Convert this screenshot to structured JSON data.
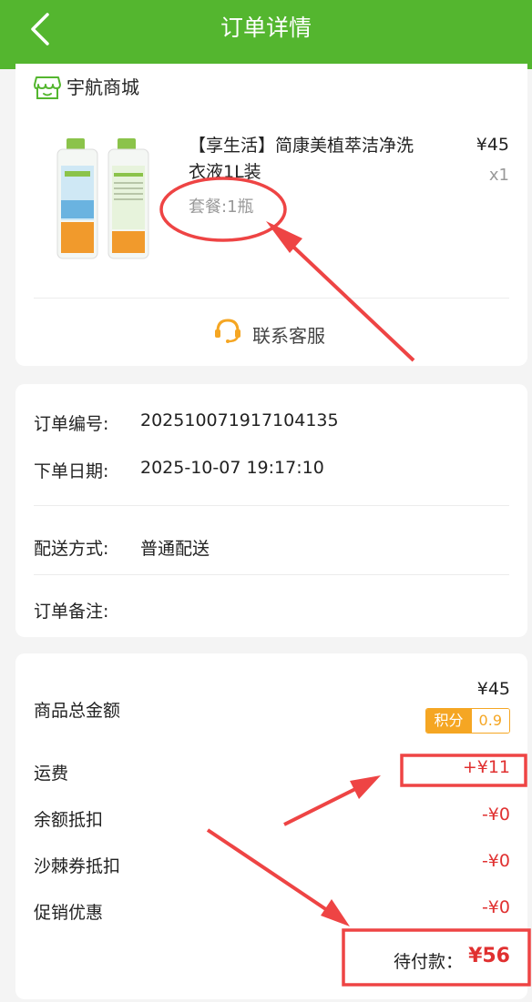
{
  "header": {
    "title": "订单详情"
  },
  "store": {
    "name": "宇航商城"
  },
  "product": {
    "title": "【享生活】简康美植萃洁净洗衣液1L装",
    "spec": "套餐:1瓶",
    "price": "¥45",
    "qty": "x1"
  },
  "service": {
    "label": "联系客服"
  },
  "order": {
    "number_label": "订单编号:",
    "number": "20251007191710413 5",
    "date_label": "下单日期:",
    "date": "2025-10-07 19:17:10",
    "delivery_label": "配送方式:",
    "delivery": "普通配送",
    "note_label": "订单备注:"
  },
  "summary": {
    "total_label": "商品总金额",
    "total": "¥45",
    "points_label": "积分",
    "points": "0.9",
    "shipping_label": "运费",
    "shipping": "+¥11",
    "balance_label": "余额抵扣",
    "balance": "-¥0",
    "coupon_label": "沙棘券抵扣",
    "coupon": "-¥0",
    "promo_label": "促销优惠",
    "promo": "-¥0",
    "pending_label": "待付款：",
    "pending": "¥56"
  },
  "colors": {
    "brand_green": "#54b62f",
    "accent_orange": "#f5a623",
    "price_red": "#e03030",
    "annotation_red": "#ee4444"
  },
  "icons": {
    "back": "back-icon",
    "store": "store-icon",
    "service": "customer-service-icon"
  }
}
